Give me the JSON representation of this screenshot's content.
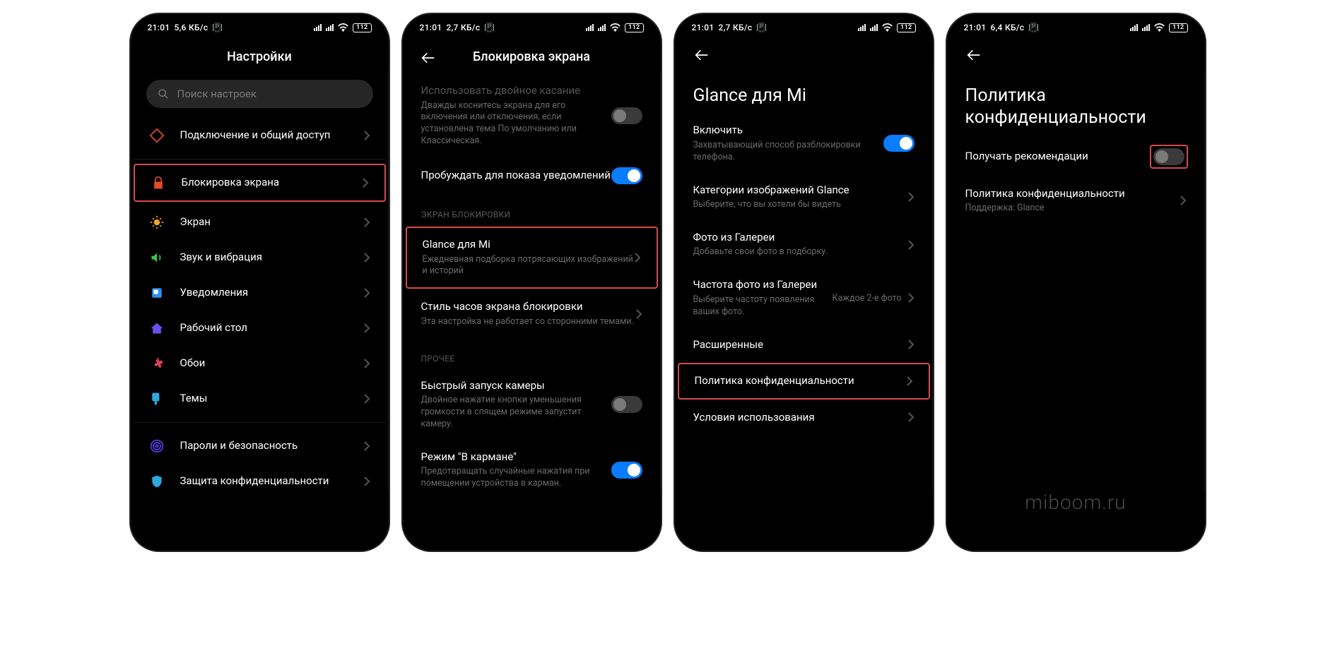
{
  "watermark": "miboom.ru",
  "screens": {
    "s1": {
      "status": {
        "time": "21:01",
        "speed": "5,6 КБ/с",
        "battery": "112"
      },
      "title": "Настройки",
      "search_placeholder": "Поиск настроек",
      "items": [
        {
          "label": "Подключение и общий доступ"
        },
        {
          "label": "Блокировка экрана"
        },
        {
          "label": "Экран"
        },
        {
          "label": "Звук и вибрация"
        },
        {
          "label": "Уведомления"
        },
        {
          "label": "Рабочий стол"
        },
        {
          "label": "Обои"
        },
        {
          "label": "Темы"
        },
        {
          "label": "Пароли и безопасность"
        },
        {
          "label": "Защита конфиденциальности"
        }
      ]
    },
    "s2": {
      "status": {
        "time": "21:01",
        "speed": "2,7 КБ/с",
        "battery": "112"
      },
      "title": "Блокировка экрана",
      "items": {
        "double_tap_label": "Использовать двойное касание",
        "double_tap_sub": "Дважды коснитесь экрана для его включения или отключения, если установлена тема По умолчанию или Классическая.",
        "wake_notif_label": "Пробуждать для показа уведомлений",
        "section_lock": "ЭКРАН БЛОКИРОВКИ",
        "glance_label": "Glance для Mi",
        "glance_sub": "Ежедневная подборка потрясающих изображений и историй",
        "clock_style_label": "Стиль часов экрана блокировки",
        "clock_style_sub": "Эта настройка не работает со сторонними темами.",
        "section_other": "ПРОЧЕЕ",
        "quick_cam_label": "Быстрый запуск камеры",
        "quick_cam_sub": "Двойное нажатие кнопки уменьшения громкости в спящем режиме запустит камеру.",
        "pocket_label": "Режим \"В кармане\"",
        "pocket_sub": "Предотвращать случайные нажатия при помещении устройства в карман."
      }
    },
    "s3": {
      "status": {
        "time": "21:01",
        "speed": "2,7 КБ/с",
        "battery": "112"
      },
      "page_title": "Glance для Mi",
      "items": {
        "enable_label": "Включить",
        "enable_sub": "Захватывающий способ разблокировки телефона.",
        "cat_label": "Категории изображений Glance",
        "cat_sub": "Выберите, что вы хотели бы видеть",
        "gallery_label": "Фото из Галереи",
        "gallery_sub": "Добавьте свои фото в подборку.",
        "freq_label": "Частота фото из Галереи",
        "freq_sub": "Выберите частоту появления ваших фото.",
        "freq_value": "Каждое 2-е фото",
        "advanced_label": "Расширенные",
        "policy_label": "Политика конфиденциальности",
        "terms_label": "Условия использования"
      }
    },
    "s4": {
      "status": {
        "time": "21:01",
        "speed": "6,4 КБ/с",
        "battery": "112"
      },
      "page_title": "Политика конфиденциальности",
      "items": {
        "rec_label": "Получать рекомендации",
        "pol_label": "Политика конфиденциальности",
        "pol_sub": "Поддержка: Glance"
      }
    }
  }
}
